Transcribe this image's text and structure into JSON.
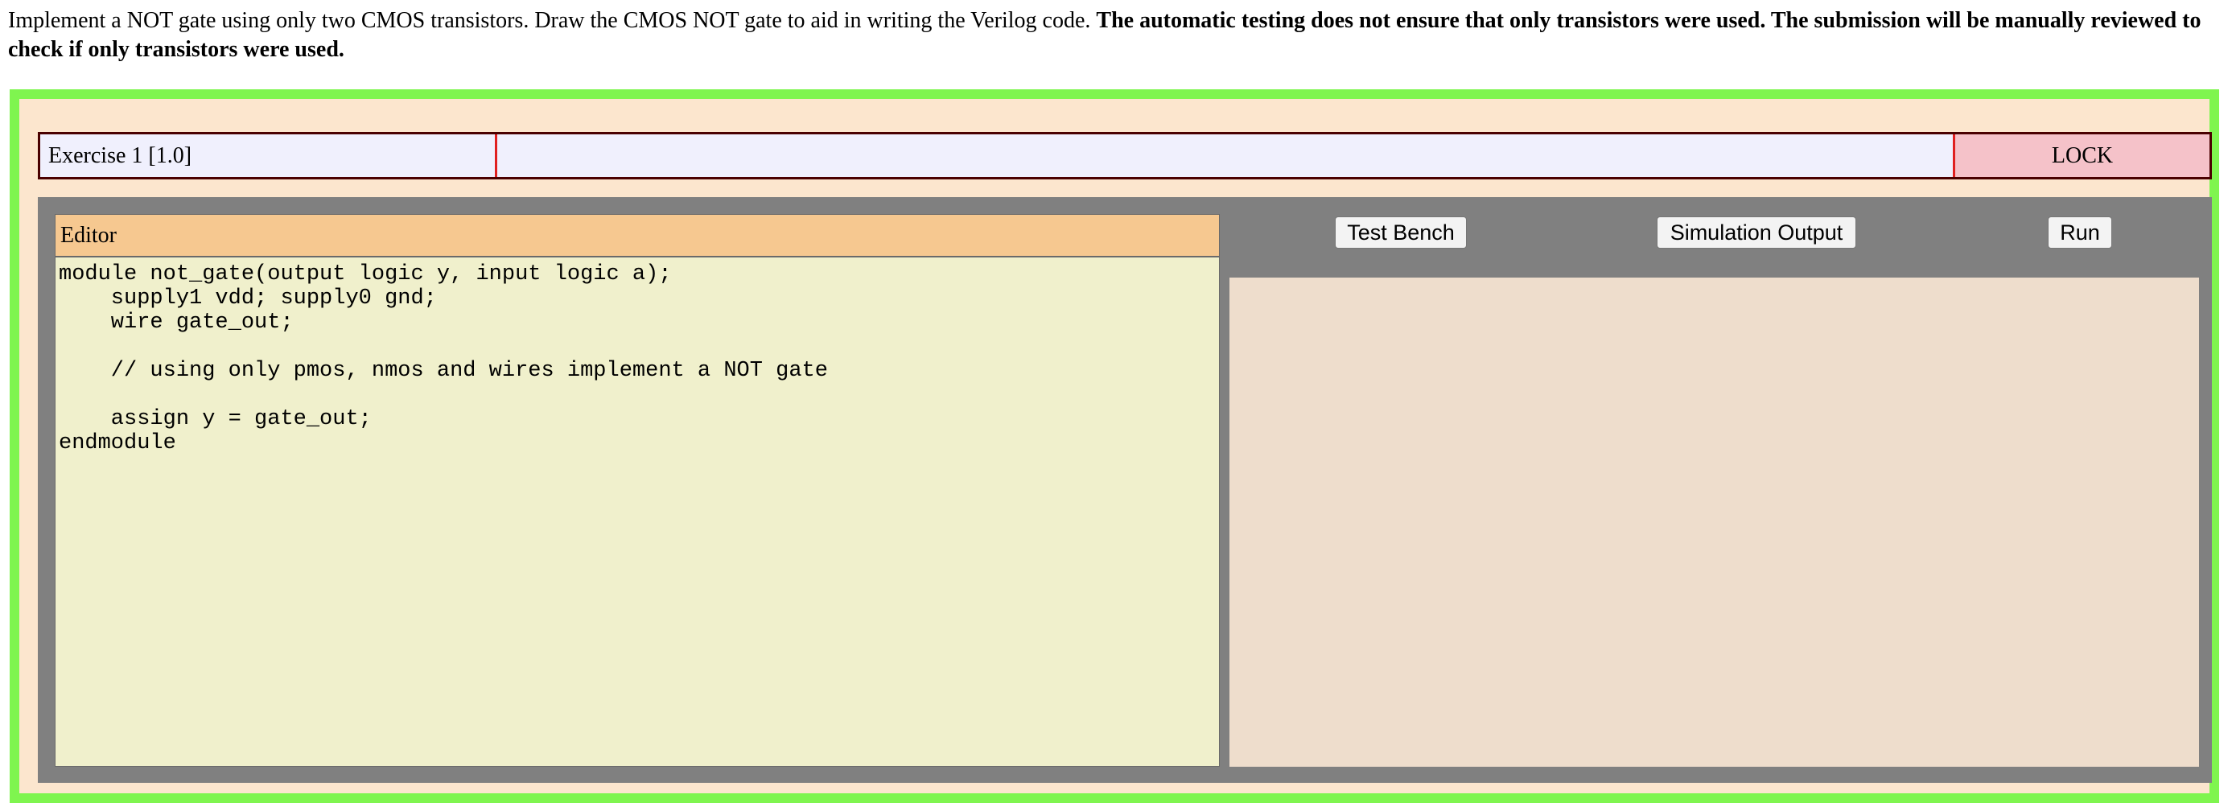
{
  "instructions": {
    "normal": "Implement a NOT gate using only two CMOS transistors. Draw the CMOS NOT gate to aid in writing the Verilog code. ",
    "bold": "The automatic testing does not ensure that only transistors were used. The submission will be manually reviewed to check if only transistors were used."
  },
  "exercise": {
    "title": "Exercise 1 [1.0]",
    "status": "",
    "lock_label": "LOCK"
  },
  "editor": {
    "title": "Editor",
    "code": "module not_gate(output logic y, input logic a);\n    supply1 vdd; supply0 gnd;\n    wire gate_out;\n\n    // using only pmos, nmos and wires implement a NOT gate\n\n    assign y = gate_out;\nendmodule"
  },
  "tabs": {
    "test_bench": "Test Bench",
    "simulation_output": "Simulation Output",
    "run": "Run"
  },
  "output": {
    "text": ""
  },
  "colors": {
    "outer_border": "#7ff54f",
    "outer_bg": "#fce6ce",
    "header_bg": "#f0f0fd",
    "lock_bg": "#f5c2c9",
    "editor_title_bg": "#f6c890",
    "editor_bg": "#f0f0cc",
    "work_bg": "#808080",
    "output_bg": "#eeddcc"
  }
}
